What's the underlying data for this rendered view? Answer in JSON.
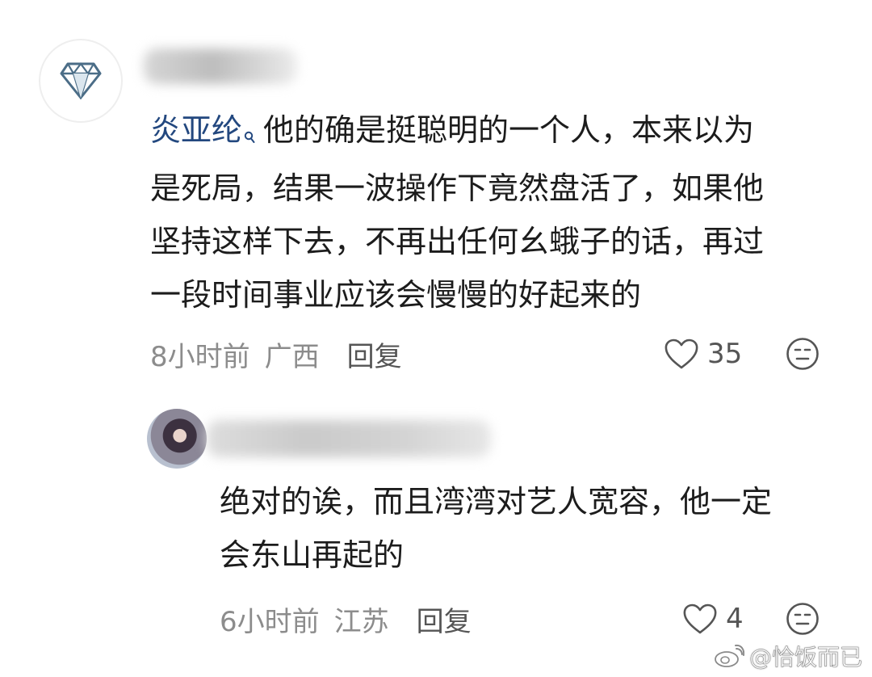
{
  "comment": {
    "mention": "炎亚纶",
    "text": "他的确是挺聪明的一个人，本来以为\n是死局，结果一波操作下竟然盘活了，如果他\n坚持这样下去，不再出任何幺蛾子的话，再过\n一段时间事业应该会慢慢的好起来的",
    "time": "8小时前",
    "region": "广西",
    "reply_label": "回复",
    "likes": "35",
    "icons": {
      "avatar": "diamond-icon",
      "mention": "search-icon",
      "like": "heart-icon",
      "emoji": "emoji-icon"
    }
  },
  "reply": {
    "text": "绝对的诶，而且湾湾对艺人宽容，他一定\n会东山再起的",
    "time": "6小时前",
    "region": "江苏",
    "reply_label": "回复",
    "likes": "4",
    "icons": {
      "like": "heart-icon",
      "emoji": "emoji-icon"
    }
  },
  "watermark": {
    "text": "@恰饭而已",
    "icon": "weibo-logo-icon"
  },
  "colors": {
    "mention": "#23487f",
    "text": "#1c1c1c",
    "meta": "#8c8c8c",
    "icon": "#555555",
    "diamond": "#4b6d87"
  }
}
